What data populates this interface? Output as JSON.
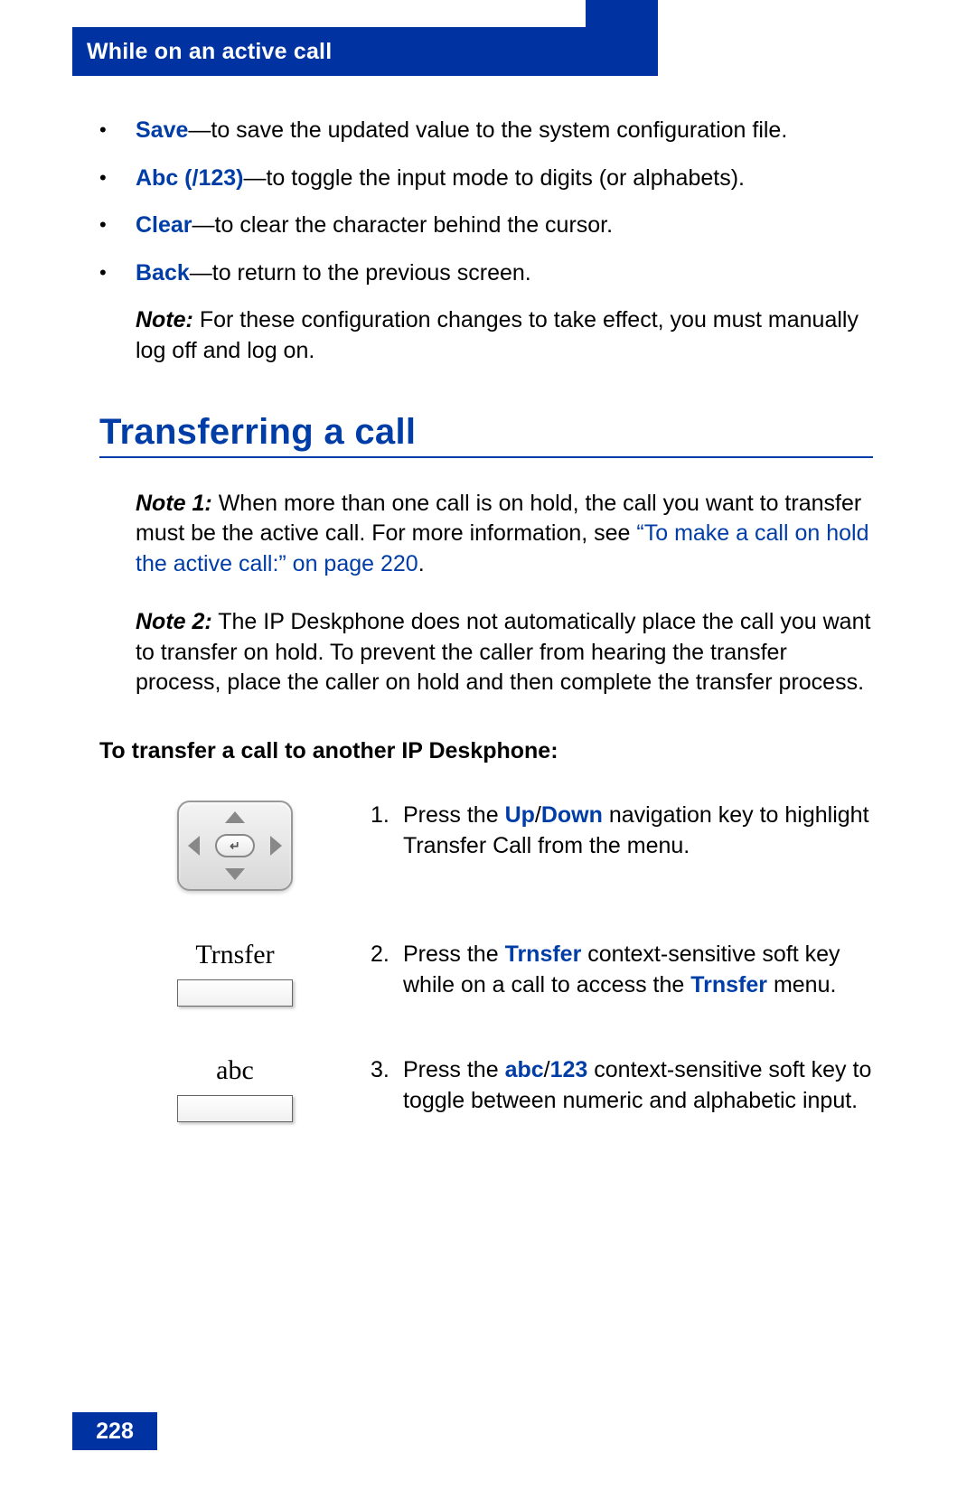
{
  "header": {
    "title": "While on an active call"
  },
  "bullets": [
    {
      "keyword": "Save",
      "text": "—to save the updated value to the system configuration file."
    },
    {
      "keyword": "Abc (/123)",
      "text": "—to toggle the input mode to digits (or alphabets)."
    },
    {
      "keyword": "Clear",
      "text": "—to clear the character behind the cursor."
    },
    {
      "keyword": "Back",
      "text": "—to return to the previous screen."
    }
  ],
  "config_note": {
    "label": "Note:",
    "text": "For these configuration changes to take effect, you must manually log off and log on."
  },
  "section_heading": "Transferring a call",
  "note1": {
    "label": "Note 1:",
    "pre": "When more than one call is on hold, the call you want to transfer must be the active call. For more information, see ",
    "link": "“To make a call on hold the active call:” on page 220",
    "post": "."
  },
  "note2": {
    "label": "Note 2:",
    "text": "The IP Deskphone does not automatically place the call you want to transfer on hold. To prevent the caller from hearing the transfer process, place the caller on hold and then complete the transfer process."
  },
  "sub_heading": "To transfer a call to another IP Deskphone:",
  "steps": [
    {
      "num": "1.",
      "parts": [
        {
          "t": "Press the "
        },
        {
          "t": "Up",
          "kw": true
        },
        {
          "t": "/"
        },
        {
          "t": "Down",
          "kw": true
        },
        {
          "t": " navigation key to highlight Transfer Call from the menu."
        }
      ]
    },
    {
      "num": "2.",
      "softkey_label": "Trnsfer",
      "parts": [
        {
          "t": "Press the "
        },
        {
          "t": "Trnsfer",
          "kw": true
        },
        {
          "t": " context-sensitive soft key while on a call to access the "
        },
        {
          "t": "Trnsfer",
          "kw": true
        },
        {
          "t": " menu."
        }
      ]
    },
    {
      "num": "3.",
      "softkey_label": "abc",
      "parts": [
        {
          "t": "Press the "
        },
        {
          "t": "abc",
          "kw": true
        },
        {
          "t": "/"
        },
        {
          "t": "123",
          "kw": true
        },
        {
          "t": " context-sensitive soft key to toggle between numeric and alphabetic input."
        }
      ]
    }
  ],
  "page_number": "228"
}
